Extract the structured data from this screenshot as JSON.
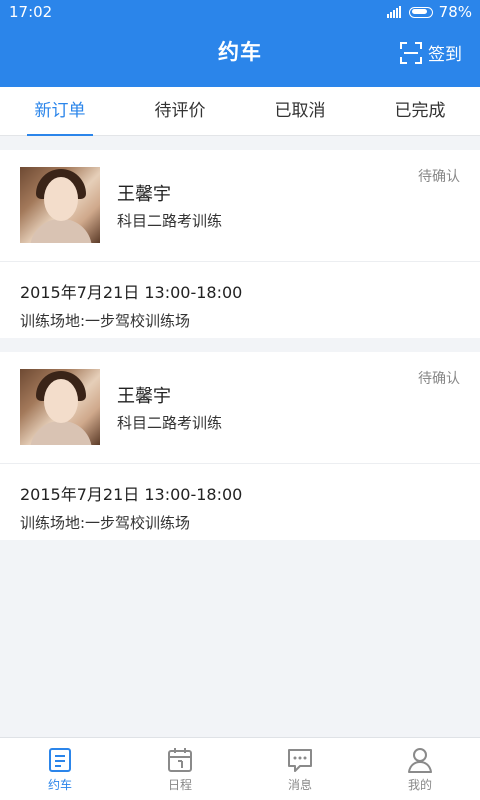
{
  "status_bar": {
    "time": "17:02",
    "battery": "78%"
  },
  "header": {
    "title": "约车",
    "checkin_label": "签到"
  },
  "tabs": [
    {
      "label": "新订单",
      "active": true
    },
    {
      "label": "待评价",
      "active": false
    },
    {
      "label": "已取消",
      "active": false
    },
    {
      "label": "已完成",
      "active": false
    }
  ],
  "orders": [
    {
      "name": "王馨宇",
      "course": "科目二路考训练",
      "status": "待确认",
      "datetime": "2015年7月21日  13:00-18:00",
      "place": "训练场地:一步驾校训练场"
    },
    {
      "name": "王馨宇",
      "course": "科目二路考训练",
      "status": "待确认",
      "datetime": "2015年7月21日  13:00-18:00",
      "place": "训练场地:一步驾校训练场"
    }
  ],
  "bottom_nav": [
    {
      "label": "约车",
      "icon": "booking-icon",
      "active": true
    },
    {
      "label": "日程",
      "icon": "calendar-icon",
      "active": false
    },
    {
      "label": "消息",
      "icon": "message-icon",
      "active": false
    },
    {
      "label": "我的",
      "icon": "user-icon",
      "active": false
    }
  ],
  "colors": {
    "primary": "#2b85ea",
    "background": "#f2f4f7"
  }
}
